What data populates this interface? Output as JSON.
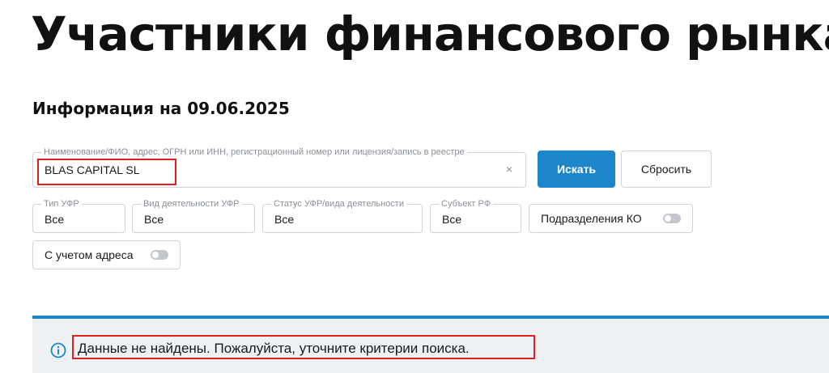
{
  "page": {
    "title": "Участники финансового рынка",
    "info_date": "Информация на 09.06.2025"
  },
  "search": {
    "label": "Наименование/ФИО, адрес, ОГРН или ИНН, регистрационный номер или лицензия/запись в реестре",
    "value": "BLAS CAPITAL SL",
    "clear_icon": "×",
    "search_button": "Искать",
    "reset_button": "Сбросить"
  },
  "filters": {
    "type": {
      "label": "Тип УФР",
      "value": "Все"
    },
    "activity": {
      "label": "Вид деятельности УФР",
      "value": "Все"
    },
    "status": {
      "label": "Статус УФР/вида деятельности",
      "value": "Все"
    },
    "region": {
      "label": "Субъект РФ",
      "value": "Все"
    },
    "ko_divisions": {
      "label": "Подразделения КО",
      "checked": false
    },
    "with_address": {
      "label": "С учетом адреса",
      "checked": false
    }
  },
  "result": {
    "icon": "info-icon",
    "message": "Данные не найдены. Пожалуйста, уточните критерии поиска."
  },
  "colors": {
    "accent": "#1b86c9",
    "highlight": "#e02020",
    "notice_bg": "#eef1f4"
  }
}
